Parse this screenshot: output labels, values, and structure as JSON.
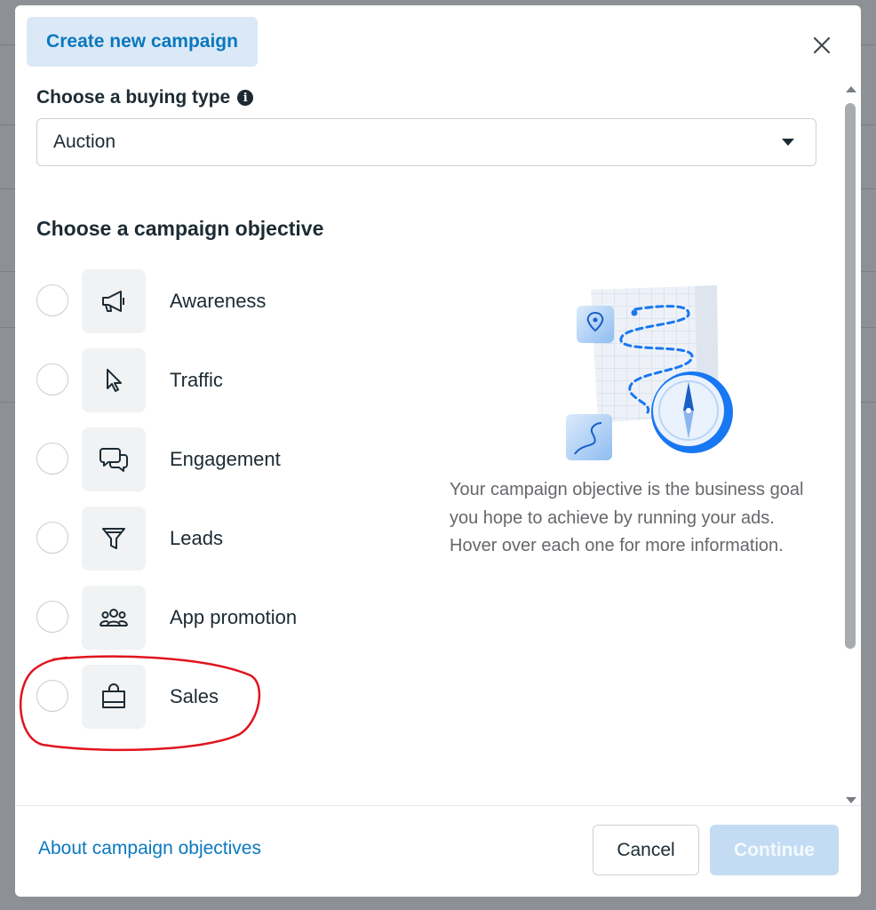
{
  "modal": {
    "title": "Create new campaign"
  },
  "buying_type": {
    "label": "Choose a buying type",
    "selected": "Auction"
  },
  "objective": {
    "heading": "Choose a campaign objective",
    "options": [
      {
        "label": "Awareness",
        "icon": "megaphone-icon"
      },
      {
        "label": "Traffic",
        "icon": "cursor-icon"
      },
      {
        "label": "Engagement",
        "icon": "chat-bubbles-icon"
      },
      {
        "label": "Leads",
        "icon": "funnel-icon"
      },
      {
        "label": "App promotion",
        "icon": "people-icon"
      },
      {
        "label": "Sales",
        "icon": "shopping-bag-icon"
      }
    ],
    "description": "Your campaign objective is the business goal you hope to achieve by running your ads. Hover over each one for more information."
  },
  "footer": {
    "about_link": "About campaign objectives",
    "cancel_label": "Cancel",
    "continue_label": "Continue"
  },
  "colors": {
    "accent": "#0a78be",
    "tab_bg": "#dbe9f6",
    "continue_disabled": "#c3dcf3",
    "annotation": "#e0141e"
  }
}
